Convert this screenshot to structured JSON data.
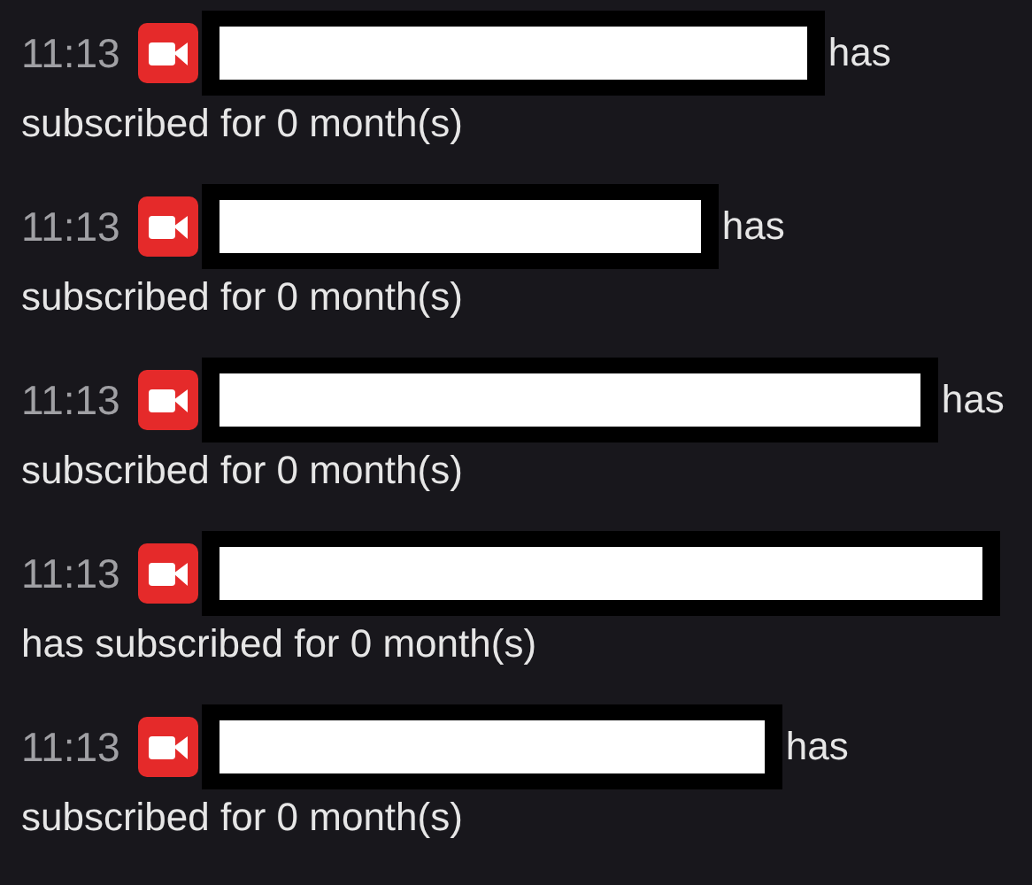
{
  "messages": [
    {
      "time": "11:13",
      "lines": [
        "has",
        "subscribed for 0 month(s)"
      ]
    },
    {
      "time": "11:13",
      "lines": [
        "has",
        "subscribed for 0 month(s)"
      ]
    },
    {
      "time": "11:13",
      "lines": [
        "has",
        "subscribed for 0 month(s)"
      ]
    },
    {
      "time": "11:13",
      "lines": [
        "has subscribed for 0 month(s)"
      ]
    },
    {
      "time": "11:13",
      "lines": [
        "has",
        "subscribed for 0 month(s)"
      ]
    }
  ]
}
